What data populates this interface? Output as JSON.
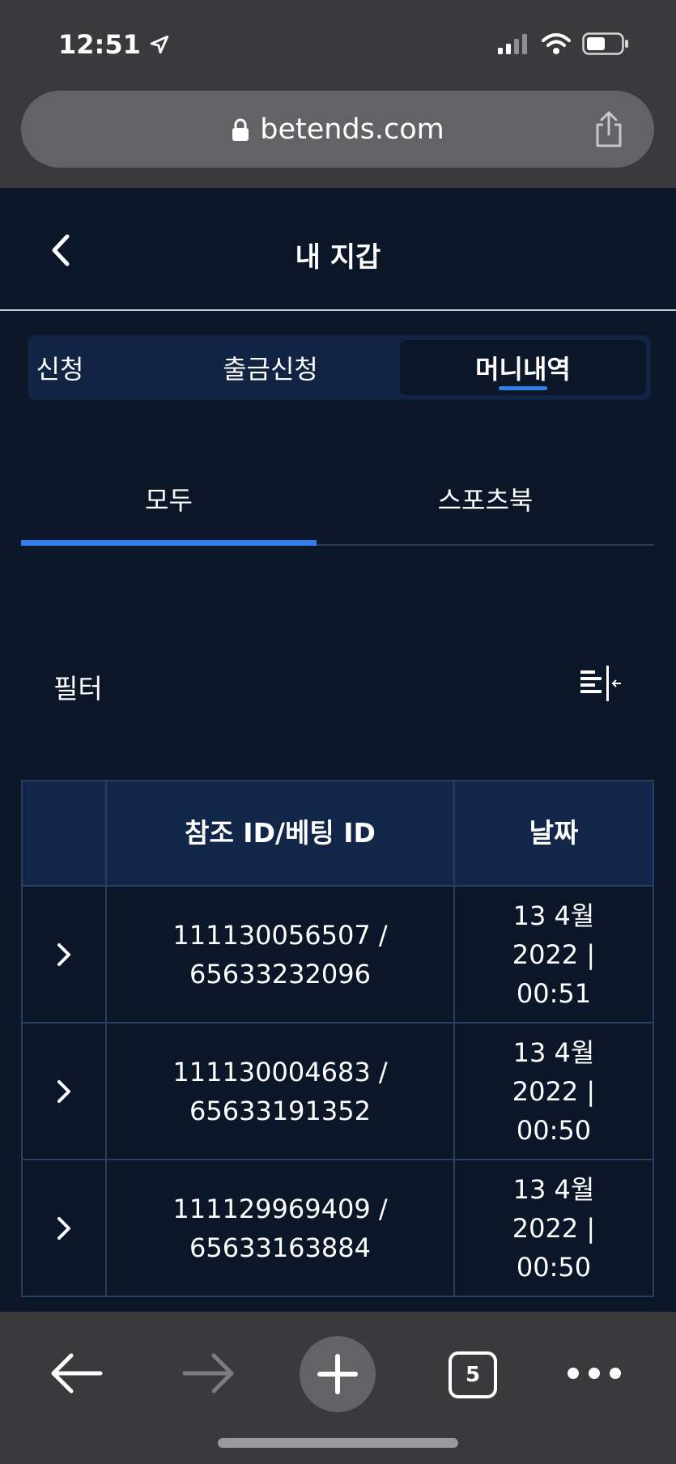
{
  "status": {
    "time": "12:51"
  },
  "browser": {
    "url": "betends.com",
    "tab_count": "5"
  },
  "header": {
    "title": "내 지갑"
  },
  "segment_tabs": [
    {
      "label": "신청"
    },
    {
      "label": "출금신청"
    },
    {
      "label": "머니내역"
    }
  ],
  "sub_tabs": [
    {
      "label": "모두"
    },
    {
      "label": "스포츠북"
    }
  ],
  "filter": {
    "label": "필터"
  },
  "table": {
    "columns": [
      "",
      "참조 ID/베팅 ID",
      "날짜"
    ],
    "rows": [
      {
        "ids_line1": "111130056507 /",
        "ids_line2": "65633232096",
        "date_line1": "13 4월",
        "date_line2": "2022 |",
        "date_line3": "00:51"
      },
      {
        "ids_line1": "111130004683 /",
        "ids_line2": "65633191352",
        "date_line1": "13 4월",
        "date_line2": "2022 |",
        "date_line3": "00:50"
      },
      {
        "ids_line1": "111129969409 /",
        "ids_line2": "65633163884",
        "date_line1": "13 4월",
        "date_line2": "2022 |",
        "date_line3": "00:50"
      }
    ]
  },
  "colors": {
    "background": "#0b1628",
    "accent": "#2f80ed",
    "table_header": "#12264a",
    "browser_chrome": "#3a3a3c"
  }
}
